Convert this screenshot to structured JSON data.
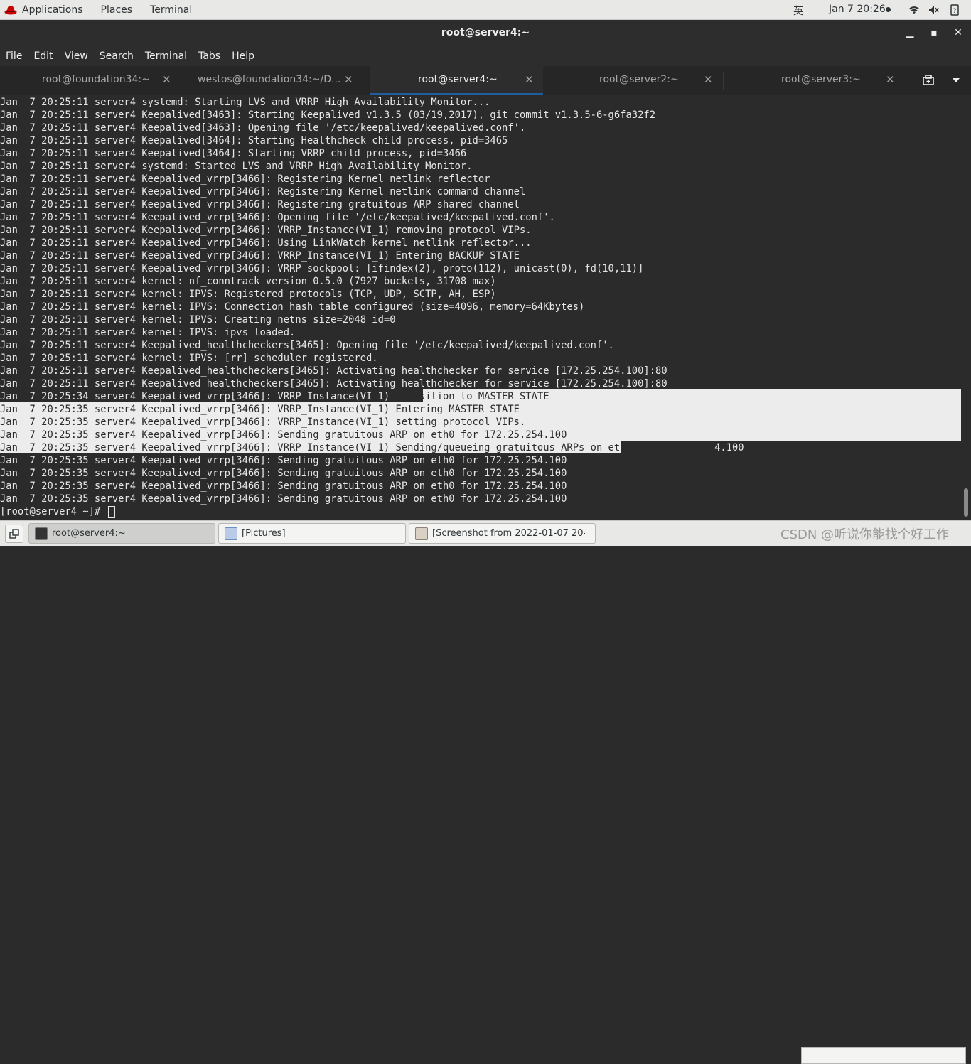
{
  "topbar": {
    "applications": "Applications",
    "places": "Places",
    "terminal": "Terminal",
    "ime": "英",
    "clock": "Jan 7  20:26",
    "icons": [
      "wifi-icon",
      "volume-icon",
      "power-icon"
    ]
  },
  "window": {
    "title": "root@server4:~",
    "controls": [
      "minimize",
      "maximize",
      "close"
    ]
  },
  "menubar": [
    "File",
    "Edit",
    "View",
    "Search",
    "Terminal",
    "Tabs",
    "Help"
  ],
  "tabs": [
    {
      "label": "root@foundation34:~",
      "active": false
    },
    {
      "label": "westos@foundation34:~/D...",
      "active": false
    },
    {
      "label": "root@server4:~",
      "active": true
    },
    {
      "label": "root@server2:~",
      "active": false
    },
    {
      "label": "root@server3:~",
      "active": false
    }
  ],
  "terminal": {
    "lines": [
      "Jan  7 20:25:11 server4 systemd: Starting LVS and VRRP High Availability Monitor...",
      "Jan  7 20:25:11 server4 Keepalived[3463]: Starting Keepalived v1.3.5 (03/19,2017), git commit v1.3.5-6-g6fa32f2",
      "Jan  7 20:25:11 server4 Keepalived[3463]: Opening file '/etc/keepalived/keepalived.conf'.",
      "Jan  7 20:25:11 server4 Keepalived[3464]: Starting Healthcheck child process, pid=3465",
      "Jan  7 20:25:11 server4 Keepalived[3464]: Starting VRRP child process, pid=3466",
      "Jan  7 20:25:11 server4 systemd: Started LVS and VRRP High Availability Monitor.",
      "Jan  7 20:25:11 server4 Keepalived_vrrp[3466]: Registering Kernel netlink reflector",
      "Jan  7 20:25:11 server4 Keepalived_vrrp[3466]: Registering Kernel netlink command channel",
      "Jan  7 20:25:11 server4 Keepalived_vrrp[3466]: Registering gratuitous ARP shared channel",
      "Jan  7 20:25:11 server4 Keepalived_vrrp[3466]: Opening file '/etc/keepalived/keepalived.conf'.",
      "Jan  7 20:25:11 server4 Keepalived_vrrp[3466]: VRRP_Instance(VI_1) removing protocol VIPs.",
      "Jan  7 20:25:11 server4 Keepalived_vrrp[3466]: Using LinkWatch kernel netlink reflector...",
      "Jan  7 20:25:11 server4 Keepalived_vrrp[3466]: VRRP_Instance(VI_1) Entering BACKUP STATE",
      "Jan  7 20:25:11 server4 Keepalived_vrrp[3466]: VRRP sockpool: [ifindex(2), proto(112), unicast(0), fd(10,11)]",
      "Jan  7 20:25:11 server4 kernel: nf_conntrack version 0.5.0 (7927 buckets, 31708 max)",
      "Jan  7 20:25:11 server4 kernel: IPVS: Registered protocols (TCP, UDP, SCTP, AH, ESP)",
      "Jan  7 20:25:11 server4 kernel: IPVS: Connection hash table configured (size=4096, memory=64Kbytes)",
      "Jan  7 20:25:11 server4 kernel: IPVS: Creating netns size=2048 id=0",
      "Jan  7 20:25:11 server4 kernel: IPVS: ipvs loaded.",
      "Jan  7 20:25:11 server4 Keepalived_healthcheckers[3465]: Opening file '/etc/keepalived/keepalived.conf'.",
      "Jan  7 20:25:11 server4 kernel: IPVS: [rr] scheduler registered.",
      "Jan  7 20:25:11 server4 Keepalived_healthcheckers[3465]: Activating healthchecker for service [172.25.254.100]:80",
      "Jan  7 20:25:11 server4 Keepalived_healthcheckers[3465]: Activating healthchecker for service [172.25.254.100]:80",
      "Jan  7 20:25:34 server4 Keepalived_vrrp[3466]: VRRP_Instance(VI_1) Transition to MASTER STATE",
      "Jan  7 20:25:35 server4 Keepalived_vrrp[3466]: VRRP_Instance(VI_1) Entering MASTER STATE",
      "Jan  7 20:25:35 server4 Keepalived_vrrp[3466]: VRRP_Instance(VI_1) setting protocol VIPs.",
      "Jan  7 20:25:35 server4 Keepalived_vrrp[3466]: Sending gratuitous ARP on eth0 for 172.25.254.100",
      "Jan  7 20:25:35 server4 Keepalived_vrrp[3466]: VRRP_Instance(VI_1) Sending/queueing gratuitous ARPs on eth0 for 172.25.254.100",
      "Jan  7 20:25:35 server4 Keepalived_vrrp[3466]: Sending gratuitous ARP on eth0 for 172.25.254.100",
      "Jan  7 20:25:35 server4 Keepalived_vrrp[3466]: Sending gratuitous ARP on eth0 for 172.25.254.100",
      "Jan  7 20:25:35 server4 Keepalived_vrrp[3466]: Sending gratuitous ARP on eth0 for 172.25.254.100",
      "Jan  7 20:25:35 server4 Keepalived_vrrp[3466]: Sending gratuitous ARP on eth0 for 172.25.254.100"
    ],
    "prompt": "[root@server4 ~]# "
  },
  "taskbar": {
    "items": [
      {
        "label": "root@server4:~",
        "icon": "terminal-icon",
        "active": true
      },
      {
        "label": "[Pictures]",
        "icon": "folder-icon",
        "active": false
      },
      {
        "label": "[Screenshot from 2022-01-07 20-...",
        "icon": "image-viewer-icon",
        "active": false
      }
    ],
    "watermark": "CSDN @听说你能找个好工作"
  },
  "colors": {
    "terminal_bg": "#2b2b2b",
    "terminal_fg": "#e6e6e6",
    "selection_bg": "#ececec",
    "accent": "#215d9c"
  }
}
